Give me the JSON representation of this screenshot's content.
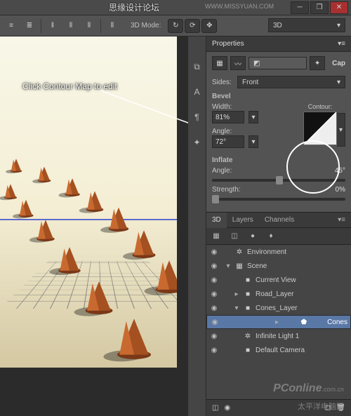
{
  "watermarks": {
    "top": "思缘设计论坛",
    "url": "WWW.MISSYUAN.COM",
    "pc": "PConline",
    "pc_sub": ".com.cn",
    "cn": "太平洋电脑网"
  },
  "toolbar": {
    "mode_label": "3D Mode:",
    "workspace": "3D"
  },
  "tooltip": "Click Contour Map to edit",
  "properties": {
    "title": "Properties",
    "cap_label": "Cap",
    "sides_label": "Sides:",
    "sides_value": "Front",
    "bevel_label": "Bevel",
    "width_label": "Width:",
    "width_value": "81%",
    "angle_label": "Angle:",
    "angle_value": "72°",
    "contour_label": "Contour:",
    "inflate_label": "Inflate",
    "inflate_angle_label": "Angle:",
    "inflate_angle_value": "45°",
    "strength_label": "Strength:",
    "strength_value": "0%"
  },
  "panel3d": {
    "tabs": [
      "3D",
      "Layers",
      "Channels"
    ],
    "items": [
      {
        "label": "Environment",
        "icon": "✲",
        "indent": 0,
        "twist": ""
      },
      {
        "label": "Scene",
        "icon": "▦",
        "indent": 0,
        "twist": "▾"
      },
      {
        "label": "Current View",
        "icon": "■",
        "indent": 1,
        "twist": ""
      },
      {
        "label": "Road_Layer",
        "icon": "■",
        "indent": 1,
        "twist": "▸"
      },
      {
        "label": "Cones_Layer",
        "icon": "■",
        "indent": 1,
        "twist": "▾"
      },
      {
        "label": "Cones",
        "icon": "⬟",
        "indent": 2,
        "twist": "▸",
        "sel": true
      },
      {
        "label": "Infinite Light 1",
        "icon": "✲",
        "indent": 1,
        "twist": ""
      },
      {
        "label": "Default Camera",
        "icon": "■",
        "indent": 1,
        "twist": ""
      }
    ]
  }
}
